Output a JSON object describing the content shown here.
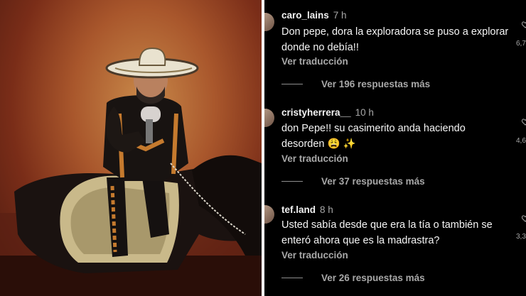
{
  "comments": [
    {
      "username": "caro_lains",
      "time": "7 h",
      "text": "Don pepe, dora la exploradora se puso a explorar donde no debía!!",
      "translate": "Ver traducción",
      "replies": "Ver 196 respuestas más",
      "likes": "6,7"
    },
    {
      "username": "cristyherrera__",
      "time": "10 h",
      "text": "don Pepe!! su casimerito anda haciendo desorden 😩 ✨",
      "translate": "Ver traducción",
      "replies": "Ver 37 respuestas más",
      "likes": "4,6"
    },
    {
      "username": "tef.land",
      "time": "8 h",
      "text": "Usted sabía desde que era la tía o también se enteró ahora que es la madrastra?",
      "translate": "Ver traducción",
      "replies": "Ver 26 respuestas más",
      "likes": "3,3"
    }
  ]
}
